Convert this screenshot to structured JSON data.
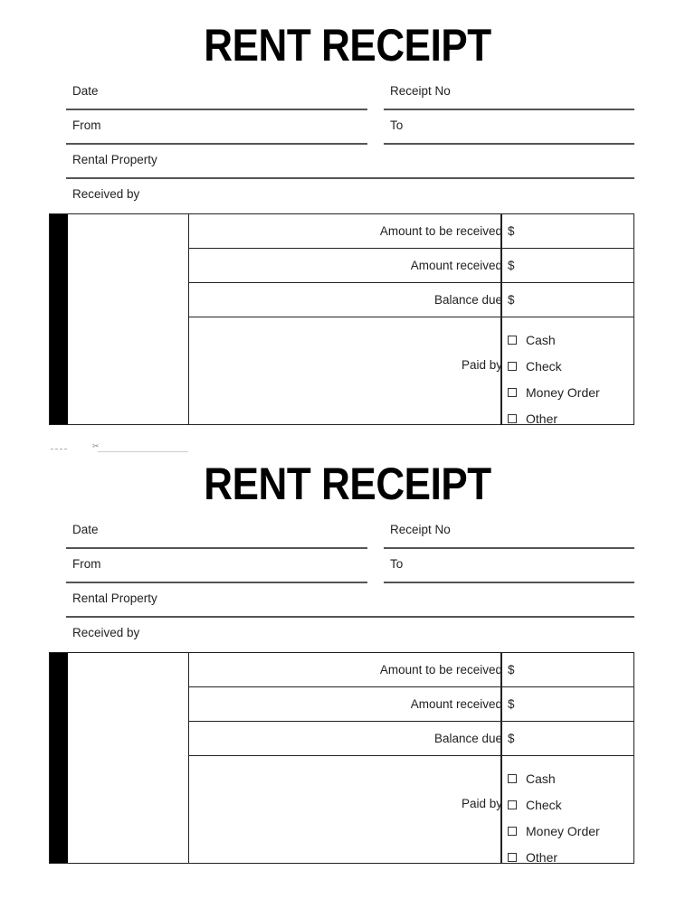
{
  "receipts": [
    {
      "title": "RENT RECEIPT",
      "fields": {
        "date": "Date",
        "receipt_no": "Receipt No",
        "from": "From",
        "to": "To",
        "rental_property": "Rental Property",
        "received_by": "Received by"
      },
      "rows": [
        {
          "label": "Amount to be received",
          "value": "$"
        },
        {
          "label": "Amount received",
          "value": "$"
        },
        {
          "label": "Balance due",
          "value": "$"
        }
      ],
      "paid_by": {
        "label": "Paid by",
        "options": [
          "Cash",
          "Check",
          "Money Order",
          "Other"
        ]
      }
    },
    {
      "title": "RENT RECEIPT",
      "fields": {
        "date": "Date",
        "receipt_no": "Receipt No",
        "from": "From",
        "to": "To",
        "rental_property": "Rental Property",
        "received_by": "Received by"
      },
      "rows": [
        {
          "label": "Amount to be received",
          "value": "$"
        },
        {
          "label": "Amount received",
          "value": "$"
        },
        {
          "label": "Balance due",
          "value": "$"
        }
      ],
      "paid_by": {
        "label": "Paid by",
        "options": [
          "Cash",
          "Check",
          "Money Order",
          "Other"
        ]
      }
    }
  ],
  "cut_line": {
    "icon": "scissors-icon",
    "glyph": "✂"
  }
}
